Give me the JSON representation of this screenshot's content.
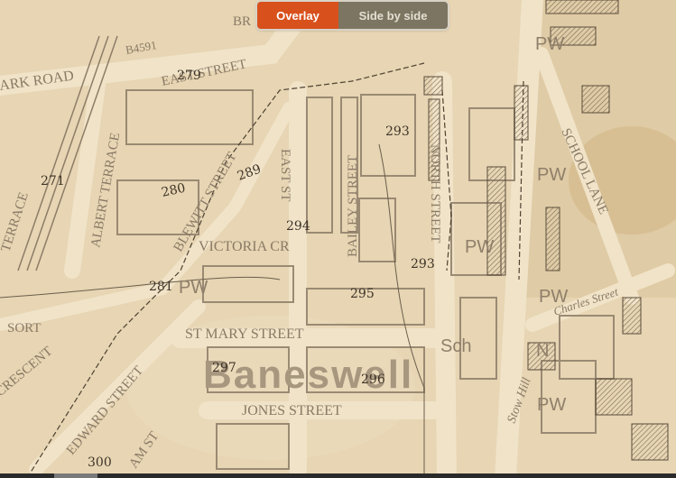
{
  "toggle": {
    "overlay_label": "Overlay",
    "side_label": "Side by side",
    "active": "overlay"
  },
  "map": {
    "title_label": "Baneswell",
    "streets": {
      "park_road": "ARK ROAD",
      "b4591": "B4591",
      "east_street_top": "EAST STREET",
      "albert_terrace": "ALBERT TERRACE",
      "terrace_left": "TERRACE",
      "blewitt_street": "BLEWITT STREET",
      "east_st_vertical": "EAST ST",
      "bailey_street": "BAILEY STREET",
      "north_street": "NORTH STREET",
      "school_lane": "SCHOOL LANE",
      "victoria_cr": "VICTORIA CR",
      "st_mary_street": "ST MARY STREET",
      "jones_street": "JONES STREET",
      "edward_street": "EDWARD STREET",
      "crescent": "CRESCENT",
      "sort": "SORT",
      "stow_hill": "Stow Hill",
      "charles_street": "Charles Street",
      "br_partial": "BR",
      "am_st_partial": "AM ST"
    },
    "numbers": [
      "271",
      "279",
      "280",
      "289",
      "293",
      "294",
      "295",
      "296",
      "297",
      "281",
      "293a",
      "300"
    ],
    "number_text": {
      "n271": "271",
      "n279": "279",
      "n280": "280",
      "n289": "289",
      "n293": "293",
      "n294": "294",
      "n295": "295",
      "n296": "296",
      "n297": "297",
      "n281": "281",
      "n293b": "293",
      "n300": "300"
    },
    "markers": {
      "pw": "PW",
      "sch": "Sch",
      "n": "N"
    }
  },
  "colors": {
    "paper": "#e8d6b4",
    "overlay_active": "#d8501c",
    "side_inactive": "#7b7561"
  }
}
